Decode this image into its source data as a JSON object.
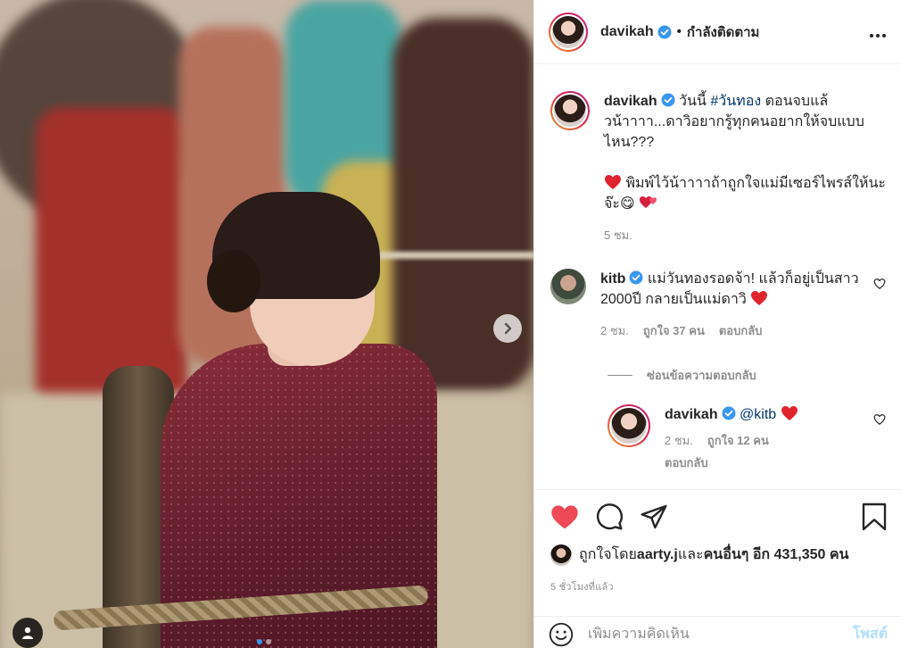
{
  "photo": {
    "carousel_dots": 2,
    "active_dot": 1,
    "next_icon": "chevron-right-icon",
    "tag_icon": "user-tag-icon"
  },
  "header": {
    "username": "davikah",
    "separator": "•",
    "follow_status": "กำลังติดตาม",
    "more_icon": "more-horizontal-icon"
  },
  "caption": {
    "username": "davikah",
    "text_before": "วันนี้ ",
    "hashtag": "#วันทอง",
    "text_after": " ตอนจบแล้วน้าาาา...ดาวิอยากรู้ทุกคนอยากให้จบแบบไหน???",
    "line2": " พิมพ์ไว้น้าาาาถ้าถูกใจแม่มีเซอร์ไพรส์ให้นะจ๊ะ",
    "emoji_1": "😋",
    "time": "5 ชม."
  },
  "comments": [
    {
      "username": "kitb",
      "text": "แม่วันทองรอดจ้า! แล้วก็อยู่เป็นสาว 2000ปี กลายเป็นแม่ดาวิ",
      "time": "2 ชม.",
      "likes": "ถูกใจ 37 คน",
      "reply_label": "ตอบกลับ",
      "view_replies": "ซ่อนข้อความตอบกลับ"
    }
  ],
  "reply": {
    "username": "davikah",
    "mention": "@kitb",
    "time": "2 ชม.",
    "likes": "ถูกใจ 12 คน",
    "reply_label": "ตอบกลับ"
  },
  "actions": {
    "like_icon": "heart-filled-icon",
    "comment_icon": "comment-icon",
    "share_icon": "share-icon",
    "save_icon": "bookmark-icon"
  },
  "likes": {
    "prefix": "ถูกใจโดย ",
    "user": "aarty.j",
    "and": " และ ",
    "others": "คนอื่นๆ อีก 431,350 คน"
  },
  "time_ago": "5 ชั่วโมงที่แล้ว",
  "add_comment": {
    "placeholder": "เพิ่มความคิดเห็น",
    "post_label": "โพสต์",
    "emoji_icon": "smiley-icon"
  },
  "colors": {
    "like_red": "#ed4956",
    "link_blue": "#00376b",
    "verified_blue": "#3897f0",
    "post_disabled": "#b2dffc"
  }
}
